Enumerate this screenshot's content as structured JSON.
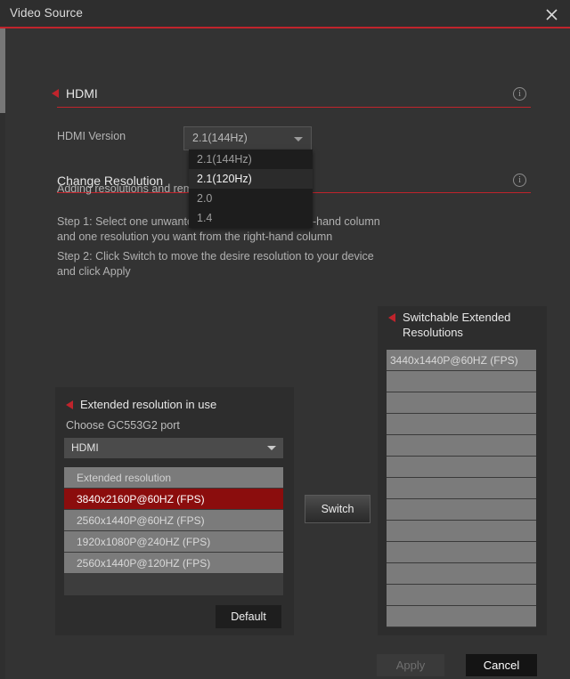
{
  "window": {
    "title": "Video Source",
    "close_icon": "close-icon"
  },
  "sections": {
    "hdmi": {
      "title": "HDMI",
      "info_icon": "info-icon",
      "marker_icon": "triangle-marker-icon"
    },
    "change_resolution": {
      "title": "Change Resolution",
      "info_icon": "info-icon",
      "marker_icon": "triangle-marker-icon"
    }
  },
  "hdmi_version": {
    "label": "HDMI Version",
    "selected": "2.1(144Hz)",
    "caret_icon": "chevron-down-icon",
    "options": [
      {
        "label": "2.1(144Hz)",
        "highlighted": false
      },
      {
        "label": "2.1(120Hz)",
        "highlighted": true
      },
      {
        "label": "2.0",
        "highlighted": false
      },
      {
        "label": "1.4",
        "highlighted": false
      }
    ]
  },
  "instructions": {
    "intro": "Adding resolutions and removing resolutions:",
    "step1_line1": "Step 1: Select one unwanted resolution from the left-hand column",
    "step1_line2": "and one resolution you want from the right-hand column",
    "step2_line1": "Step 2: Click Switch to move the desire resolution to your device",
    "step2_line2": "and click Apply"
  },
  "left_panel": {
    "title": "Extended resolution in use",
    "marker_icon": "triangle-marker-icon",
    "port_label": "Choose GC553G2 port",
    "port_selected": "HDMI",
    "port_caret_icon": "chevron-down-icon",
    "list_header": "Extended resolution",
    "rows": [
      {
        "label": "3840x2160P@60HZ (FPS)",
        "state": "selected"
      },
      {
        "label": "2560x1440P@60HZ (FPS)",
        "state": "normal"
      },
      {
        "label": "1920x1080P@240HZ (FPS)",
        "state": "normal"
      },
      {
        "label": "2560x1440P@120HZ (FPS)",
        "state": "normal"
      },
      {
        "label": "",
        "state": "blank"
      }
    ],
    "default_button": "Default"
  },
  "right_panel": {
    "title_line1": "Switchable Extended",
    "title_line2": "Resolutions",
    "marker_icon": "triangle-marker-icon",
    "rows": [
      {
        "label": "3440x1440P@60HZ (FPS)",
        "state": "normal"
      },
      {
        "label": "",
        "state": "empty"
      },
      {
        "label": "",
        "state": "empty"
      },
      {
        "label": "",
        "state": "empty"
      },
      {
        "label": "",
        "state": "empty"
      },
      {
        "label": "",
        "state": "empty"
      },
      {
        "label": "",
        "state": "empty"
      },
      {
        "label": "",
        "state": "empty"
      },
      {
        "label": "",
        "state": "empty"
      },
      {
        "label": "",
        "state": "empty"
      },
      {
        "label": "",
        "state": "empty"
      },
      {
        "label": "",
        "state": "empty"
      },
      {
        "label": "",
        "state": "empty"
      }
    ]
  },
  "switch_button": "Switch",
  "footer": {
    "apply": "Apply",
    "cancel": "Cancel"
  },
  "colors": {
    "accent_red": "#c0242c",
    "selected_row_red": "#8b0d0d",
    "window_bg": "#333333",
    "panel_bg": "#2d2d2d",
    "row_gray": "#7b7b7b"
  }
}
